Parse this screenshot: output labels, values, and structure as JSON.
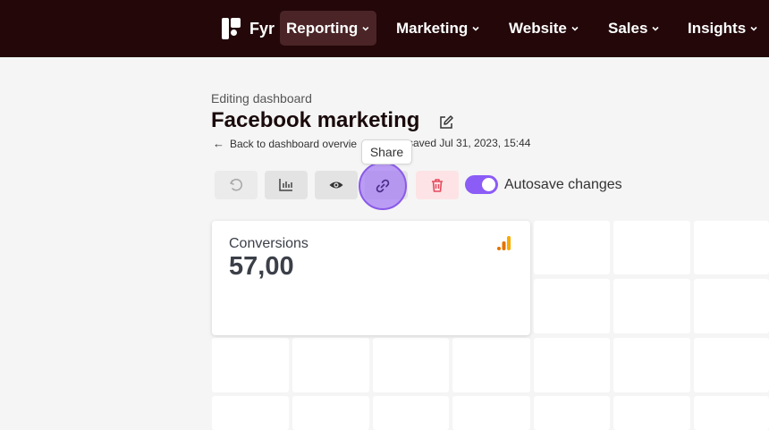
{
  "nav": {
    "logo_text": "Fyr",
    "items": [
      {
        "label": "Reporting",
        "active": true
      },
      {
        "label": "Marketing",
        "active": false
      },
      {
        "label": "Website",
        "active": false
      },
      {
        "label": "Sales",
        "active": false
      },
      {
        "label": "Insights",
        "active": false
      }
    ]
  },
  "header": {
    "editing_label": "Editing dashboard",
    "title": "Facebook marketing",
    "back_link": "Back to dashboard overvie",
    "saved_text": "saved Jul 31, 2023, 15:44"
  },
  "toolbar": {
    "tooltip": "Share",
    "autosave_label": "Autosave changes",
    "autosave_on": true
  },
  "widget": {
    "title": "Conversions",
    "value": "57,00"
  },
  "colors": {
    "topbar": "#230709",
    "accent": "#8b5cf6",
    "delete": "#e54b5e"
  }
}
